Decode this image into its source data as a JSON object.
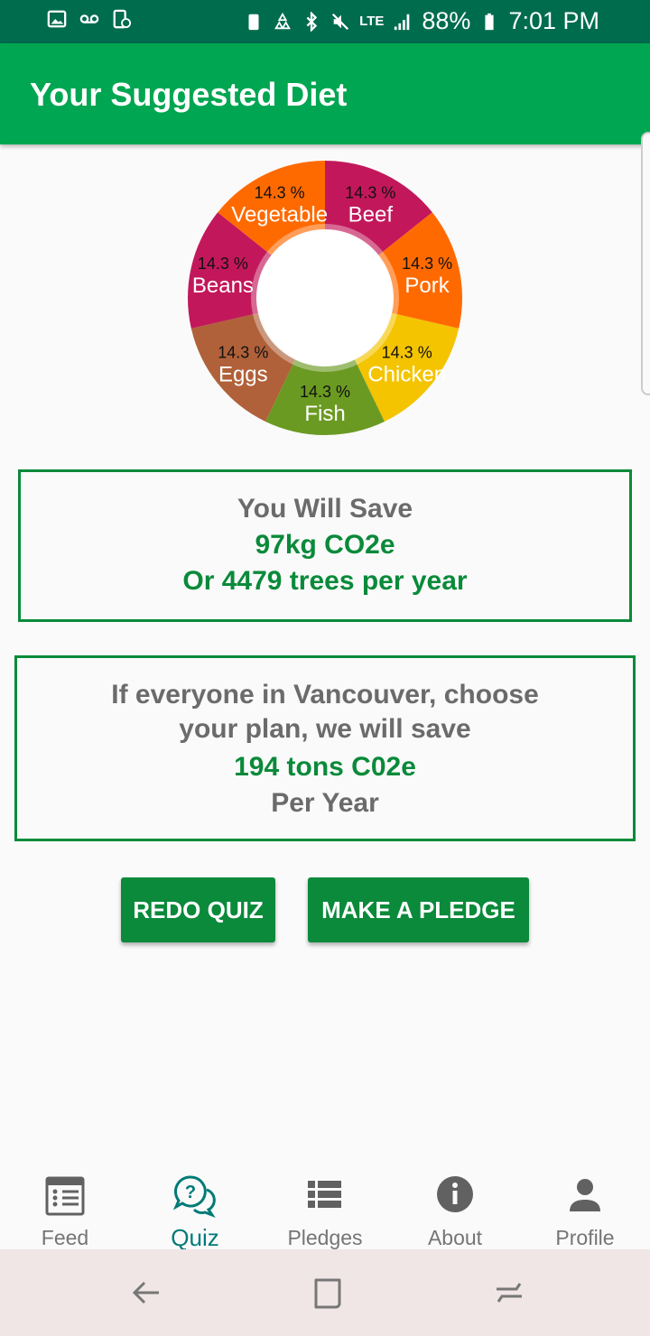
{
  "status_bar": {
    "battery": "88%",
    "time": "7:01 PM",
    "network": "LTE"
  },
  "app_bar": {
    "title": "Your Suggested Diet"
  },
  "chart_data": {
    "type": "pie",
    "categories": [
      "Beef",
      "Pork",
      "Chicken",
      "Fish",
      "Eggs",
      "Beans",
      "Vegetable"
    ],
    "values": [
      14.3,
      14.3,
      14.3,
      14.3,
      14.3,
      14.3,
      14.3
    ],
    "value_labels": [
      "14.3 %",
      "14.3 %",
      "14.3 %",
      "14.3 %",
      "14.3 %",
      "14.3 %",
      "14.3 %"
    ],
    "colors": [
      "#c2185b",
      "#ff6a00",
      "#f4c400",
      "#6b9a22",
      "#b0613a",
      "#c2185b",
      "#ff6a00"
    ],
    "donut": true
  },
  "savings_card": {
    "heading": "You Will Save",
    "amount": "97kg CO2e",
    "trees": "Or 4479 trees per year"
  },
  "city_card": {
    "heading": "If everyone in Vancouver, choose your plan, we will save",
    "amount": "194 tons C02e",
    "period": "Per Year"
  },
  "buttons": {
    "redo": "REDO QUIZ",
    "pledge": "MAKE A PLEDGE"
  },
  "bottom_nav": {
    "items": [
      {
        "label": "Feed",
        "icon": "feed-icon"
      },
      {
        "label": "Quiz",
        "icon": "quiz-icon",
        "active": true
      },
      {
        "label": "Pledges",
        "icon": "list-icon"
      },
      {
        "label": "About",
        "icon": "info-icon"
      },
      {
        "label": "Profile",
        "icon": "person-icon"
      }
    ]
  },
  "colors": {
    "primary": "#00a651",
    "status_bar": "#006c4e",
    "accent_green": "#0a8a3a",
    "active_nav": "#007a78"
  }
}
